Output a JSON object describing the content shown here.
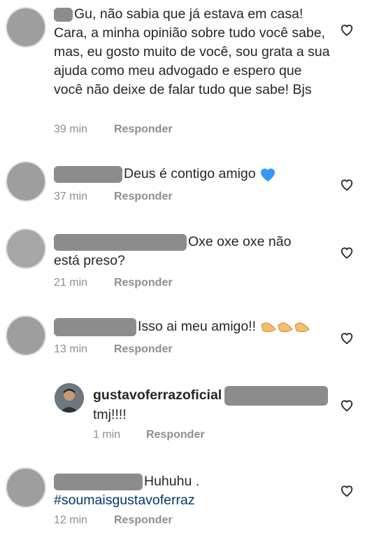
{
  "comments": [
    {
      "text": "Gu, não sabia que já estava em casa! Cara, a minha opinião sobre tudo você sabe, mas, eu gosto muito de você, sou grata a sua ajuda como meu advogado e espero que você não deixe de falar tudo que sabe! Bjs",
      "time": "39 min",
      "reply": "Responder"
    },
    {
      "text": "Deus é contigo amigo",
      "emoji": "blue-heart-icon",
      "time": "37 min",
      "reply": "Responder"
    },
    {
      "text_line1": "Oxe oxe oxe não",
      "text_line2": "está preso?",
      "time": "21 min",
      "reply": "Responder"
    },
    {
      "text": "Isso ai meu amigo!!",
      "emoji": "flexed-biceps-icon",
      "time": "13 min",
      "reply": "Responder"
    },
    {
      "username": "gustavoferrazoficial",
      "text": "tmj!!!!",
      "time": "1 min",
      "reply": "Responder"
    },
    {
      "text": "Huhuhu .",
      "hashtag": "#soumaisgustavoferraz",
      "time": "12 min",
      "reply": "Responder"
    }
  ],
  "colors": {
    "text": "#262626",
    "meta": "#8e8e8e",
    "hashtag": "#00376b",
    "redaction": "#8c8c8c",
    "heart_emoji": "#3897f0"
  }
}
